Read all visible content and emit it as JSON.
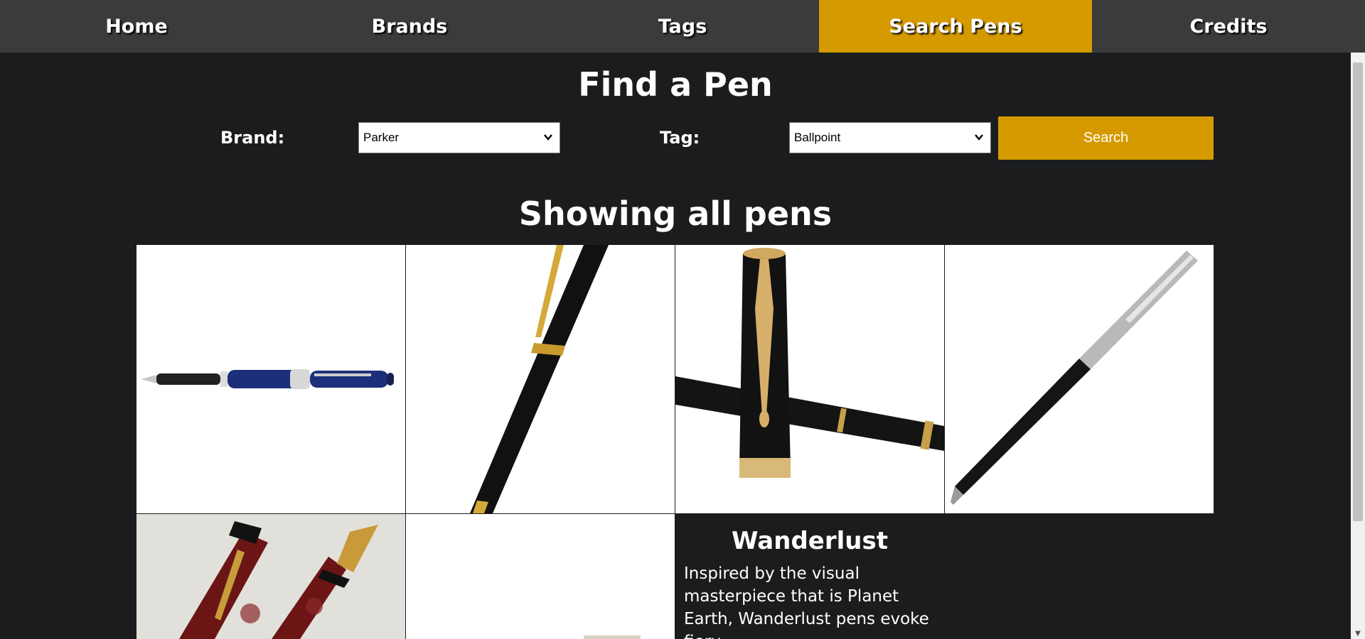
{
  "nav": {
    "items": [
      {
        "label": "Home"
      },
      {
        "label": "Brands"
      },
      {
        "label": "Tags"
      },
      {
        "label": "Search Pens",
        "active": true
      },
      {
        "label": "Credits"
      }
    ],
    "active_color": "#d49a00",
    "bg_color": "#3b3b3b"
  },
  "search": {
    "title": "Find a Pen",
    "brand_label": "Brand:",
    "brand_value": "Parker",
    "tag_label": "Tag:",
    "tag_value": "Ballpoint",
    "button_label": "Search"
  },
  "results": {
    "heading": "Showing all pens",
    "featured": {
      "title": "Wanderlust",
      "description": "Inspired by the visual masterpiece that is Planet Earth, Wanderlust pens evoke fiery"
    }
  },
  "colors": {
    "page_bg": "#1b1c1e",
    "accent": "#d49a00"
  }
}
